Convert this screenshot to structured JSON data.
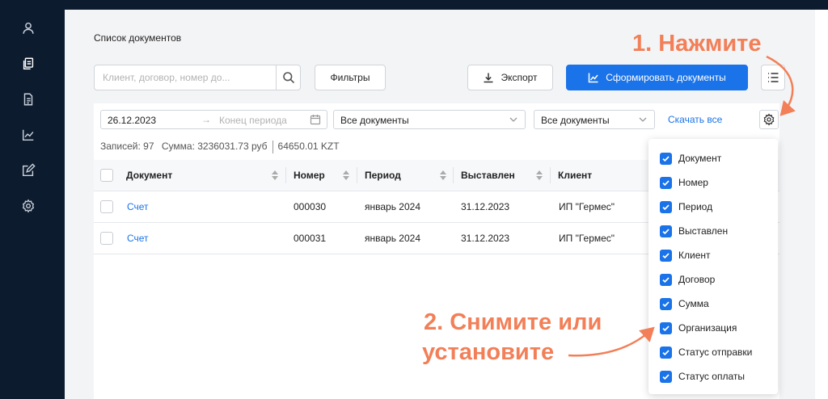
{
  "page": {
    "title": "Список документов"
  },
  "toolbar": {
    "search_placeholder": "Клиент, договор, номер до...",
    "filters_label": "Фильтры",
    "export_label": "Экспорт",
    "generate_label": "Сформировать документы"
  },
  "filters": {
    "date_start": "26.12.2023",
    "date_end_placeholder": "Конец периода",
    "select_doc_type": "Все документы",
    "select_doc_status": "Все документы",
    "download_all": "Скачать все"
  },
  "summary": {
    "records": "Записей: 97",
    "sum": "Сумма: 3236031.73 руб",
    "sum_kzt": "64650.01 KZT"
  },
  "table": {
    "headers": [
      "Документ",
      "Номер",
      "Период",
      "Выставлен",
      "Клиент"
    ],
    "rows": [
      [
        "Счет",
        "000030",
        "январь 2024",
        "31.12.2023",
        "ИП \"Гермес\""
      ],
      [
        "Счет",
        "000031",
        "январь 2024",
        "31.12.2023",
        "ИП \"Гермес\""
      ]
    ]
  },
  "columns_popup": {
    "items": [
      {
        "label": "Документ",
        "checked": true
      },
      {
        "label": "Номер",
        "checked": true
      },
      {
        "label": "Период",
        "checked": true
      },
      {
        "label": "Выставлен",
        "checked": true
      },
      {
        "label": "Клиент",
        "checked": true
      },
      {
        "label": "Договор",
        "checked": true
      },
      {
        "label": "Сумма",
        "checked": true
      },
      {
        "label": "Организация",
        "checked": true
      },
      {
        "label": "Статус отправки",
        "checked": true
      },
      {
        "label": "Статус оплаты",
        "checked": true
      }
    ]
  },
  "annotations": {
    "step1": "1. Нажмите",
    "step2_line1": "2. Снимите или",
    "step2_line2": "установите"
  },
  "colors": {
    "accent": "#1a73e8",
    "annotation": "#f27f57",
    "sidebar": "#0d1b2e"
  },
  "icons": {
    "sidebar": [
      "user-icon",
      "documents-icon",
      "document-list-icon",
      "chart-icon",
      "edit-icon",
      "settings-icon"
    ]
  }
}
